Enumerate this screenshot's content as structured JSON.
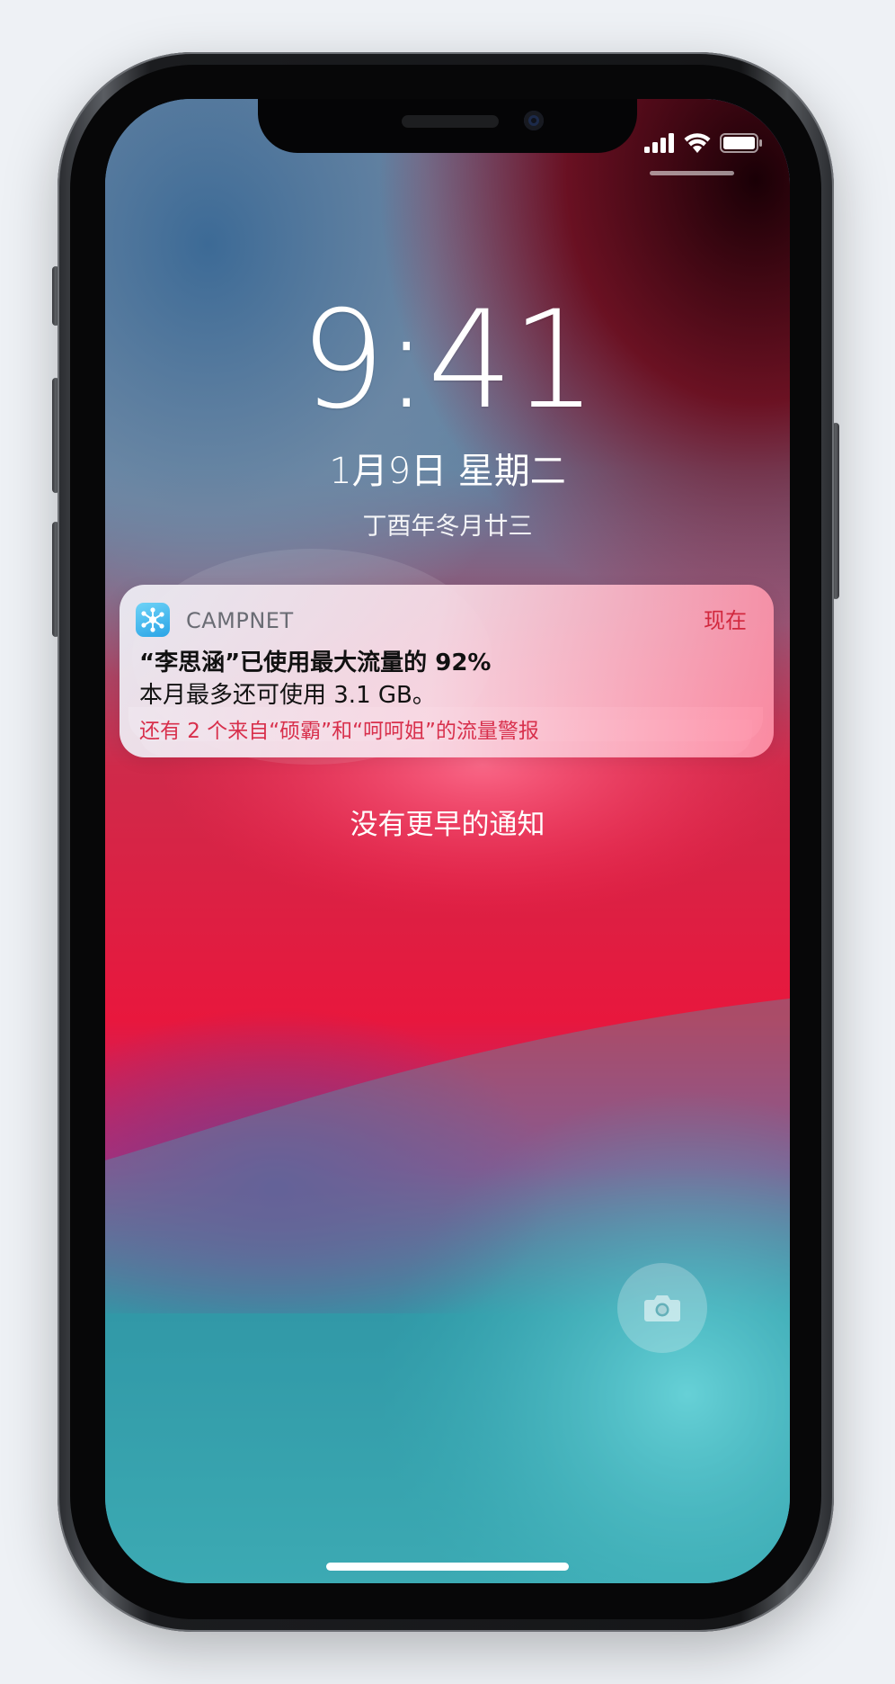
{
  "status_bar": {
    "icons": [
      "signal-icon",
      "wifi-icon",
      "battery-icon"
    ]
  },
  "lockscreen": {
    "time": "9:41",
    "date": "1月9日 星期二",
    "lunar_date": "丁酉年冬月廿三"
  },
  "notification": {
    "app_name": "CAMPNET",
    "app_icon": "network-nodes-icon",
    "time": "现在",
    "title": "“李思涵”已使用最大流量的 92%",
    "body": "本月最多还可使用 3.1 GB。",
    "more": "还有 2 个来自“硕霸”和“呵呵姐”的流量警报"
  },
  "no_older_notifications": "没有更早的通知",
  "controls": {
    "camera_icon": "camera-icon"
  },
  "colors": {
    "accent_red": "#d2283e",
    "app_icon_blue": "#2aa4e6"
  }
}
